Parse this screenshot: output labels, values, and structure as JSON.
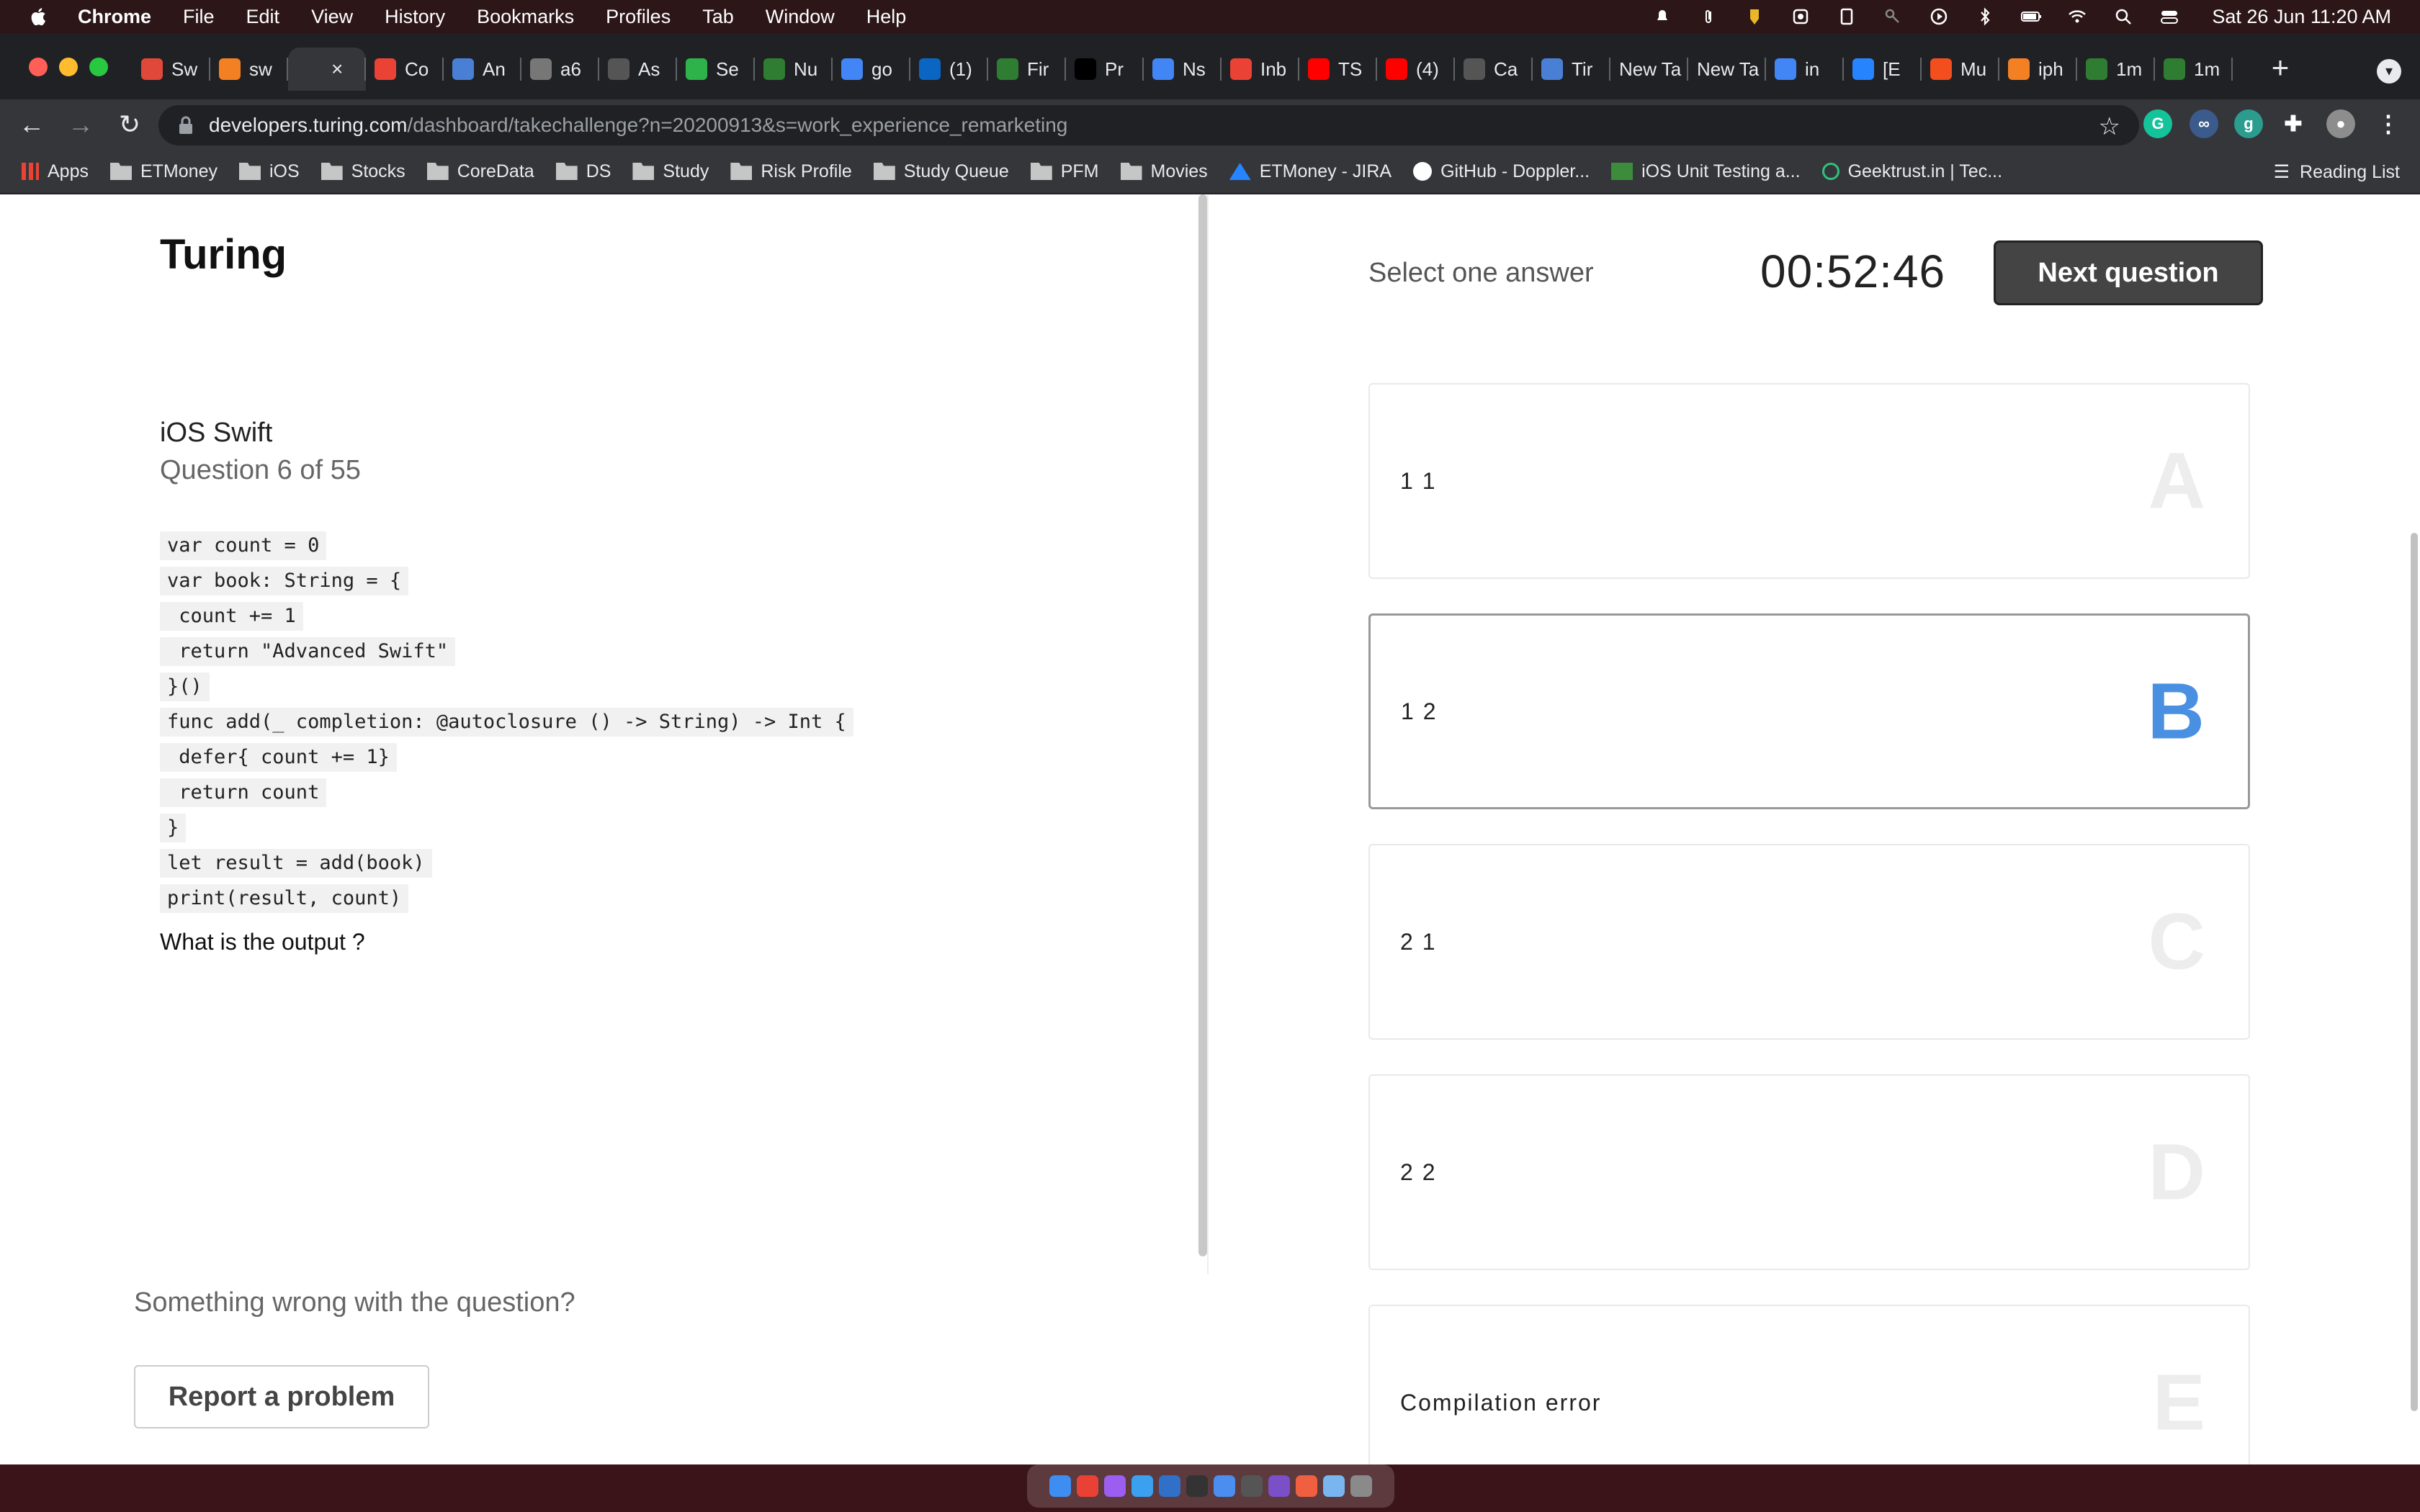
{
  "menubar": {
    "app_name": "Chrome",
    "items": [
      "File",
      "Edit",
      "View",
      "History",
      "Bookmarks",
      "Profiles",
      "Tab",
      "Window",
      "Help"
    ],
    "clock": "Sat 26 Jun  11:20 AM"
  },
  "tabs": [
    {
      "label": "Sw",
      "icon": "speakerdeck-icon",
      "color": "#e0483a"
    },
    {
      "label": "sw",
      "icon": "stackoverflow-icon",
      "color": "#f48024"
    },
    {
      "label": "",
      "icon": "turing-icon",
      "color": "#35363a",
      "active": true
    },
    {
      "label": "Co",
      "icon": "gmail-icon",
      "color": "#ea4335"
    },
    {
      "label": "An",
      "icon": "dev-d-icon",
      "color": "#4a7fd6"
    },
    {
      "label": "a6",
      "icon": "globe-icon",
      "color": "#777"
    },
    {
      "label": "As",
      "icon": "list-icon",
      "color": "#555"
    },
    {
      "label": "Se",
      "icon": "phone-icon",
      "color": "#2db34a"
    },
    {
      "label": "Nu",
      "icon": "leetcode-icon",
      "color": "#2e7d32"
    },
    {
      "label": "go",
      "icon": "google-icon",
      "color": "#4285f4"
    },
    {
      "label": "(1)",
      "icon": "linkedin-icon",
      "color": "#0a66c2"
    },
    {
      "label": "Fir",
      "icon": "leetcode-icon",
      "color": "#2e7d32"
    },
    {
      "label": "Pr",
      "icon": "medium-icon",
      "color": "#000"
    },
    {
      "label": "Ns",
      "icon": "google-icon",
      "color": "#4285f4"
    },
    {
      "label": "Inb",
      "icon": "gmail-icon",
      "color": "#ea4335"
    },
    {
      "label": "TS",
      "icon": "youtube-icon",
      "color": "#ff0000"
    },
    {
      "label": "(4)",
      "icon": "youtube-icon",
      "color": "#ff0000"
    },
    {
      "label": "Ca",
      "icon": "dots-icon",
      "color": "#555"
    },
    {
      "label": "Tir",
      "icon": "dev-d-icon",
      "color": "#4a7fd6"
    },
    {
      "label": "New Ta",
      "icon": "",
      "color": ""
    },
    {
      "label": "New Ta",
      "icon": "",
      "color": ""
    },
    {
      "label": "in",
      "icon": "google-icon",
      "color": "#4285f4"
    },
    {
      "label": "[E",
      "icon": "jira-icon",
      "color": "#2684ff"
    },
    {
      "label": "Mu",
      "icon": "figma-icon",
      "color": "#f24e1e"
    },
    {
      "label": "iph",
      "icon": "stackoverflow-icon",
      "color": "#f48024"
    },
    {
      "label": "1m",
      "icon": "leetcode-icon",
      "color": "#2e7d32"
    },
    {
      "label": "1m",
      "icon": "leetcode-icon",
      "color": "#2e7d32"
    }
  ],
  "omnibox": {
    "domain": "developers.turing.com",
    "path": "/dashboard/takechallenge?n=20200913&s=work_experience_remarketing"
  },
  "bookmarks": [
    {
      "label": "Apps",
      "icon": "apps-grid-icon"
    },
    {
      "label": "ETMoney",
      "icon": "folder-icon"
    },
    {
      "label": "iOS",
      "icon": "folder-icon"
    },
    {
      "label": "Stocks",
      "icon": "folder-icon"
    },
    {
      "label": "CoreData",
      "icon": "folder-icon"
    },
    {
      "label": "DS",
      "icon": "folder-icon"
    },
    {
      "label": "Study",
      "icon": "folder-icon"
    },
    {
      "label": "Risk Profile",
      "icon": "folder-icon"
    },
    {
      "label": "Study Queue",
      "icon": "folder-icon"
    },
    {
      "label": "PFM",
      "icon": "folder-icon"
    },
    {
      "label": "Movies",
      "icon": "folder-icon"
    },
    {
      "label": "ETMoney - JIRA",
      "icon": "jira-icon"
    },
    {
      "label": "GitHub - Doppler...",
      "icon": "github-icon"
    },
    {
      "label": "iOS Unit Testing a...",
      "icon": "bookmark-page-icon"
    },
    {
      "label": "Geektrust.in | Tec...",
      "icon": "geektrust-icon"
    }
  ],
  "reading_list": "Reading List",
  "page": {
    "logo": "Turing",
    "subject": "iOS Swift",
    "question_number": "Question 6 of 55",
    "code_lines": [
      "var count = 0",
      "var book: String = {",
      " count += 1",
      " return \"Advanced Swift\"",
      "}()",
      "func add(_ completion: @autoclosure () -> String) -> Int {",
      " defer{ count += 1}",
      " return count",
      "}",
      "let result = add(book)",
      "print(result, count)"
    ],
    "prompt": "What is the output ?",
    "report_text": "Something wrong with the question?",
    "report_button": "Report a problem",
    "select_label": "Select one answer",
    "timer": "00:52:46",
    "next_button": "Next question",
    "options": [
      {
        "letter": "A",
        "text": "1 1",
        "selected": false
      },
      {
        "letter": "B",
        "text": "1 2",
        "selected": true
      },
      {
        "letter": "C",
        "text": "2 1",
        "selected": false
      },
      {
        "letter": "D",
        "text": "2 2",
        "selected": false
      },
      {
        "letter": "E",
        "text": "Compilation error",
        "selected": false
      }
    ]
  },
  "colors": {
    "selected_letter": "#4a90e2",
    "next_button_bg": "#444444"
  }
}
